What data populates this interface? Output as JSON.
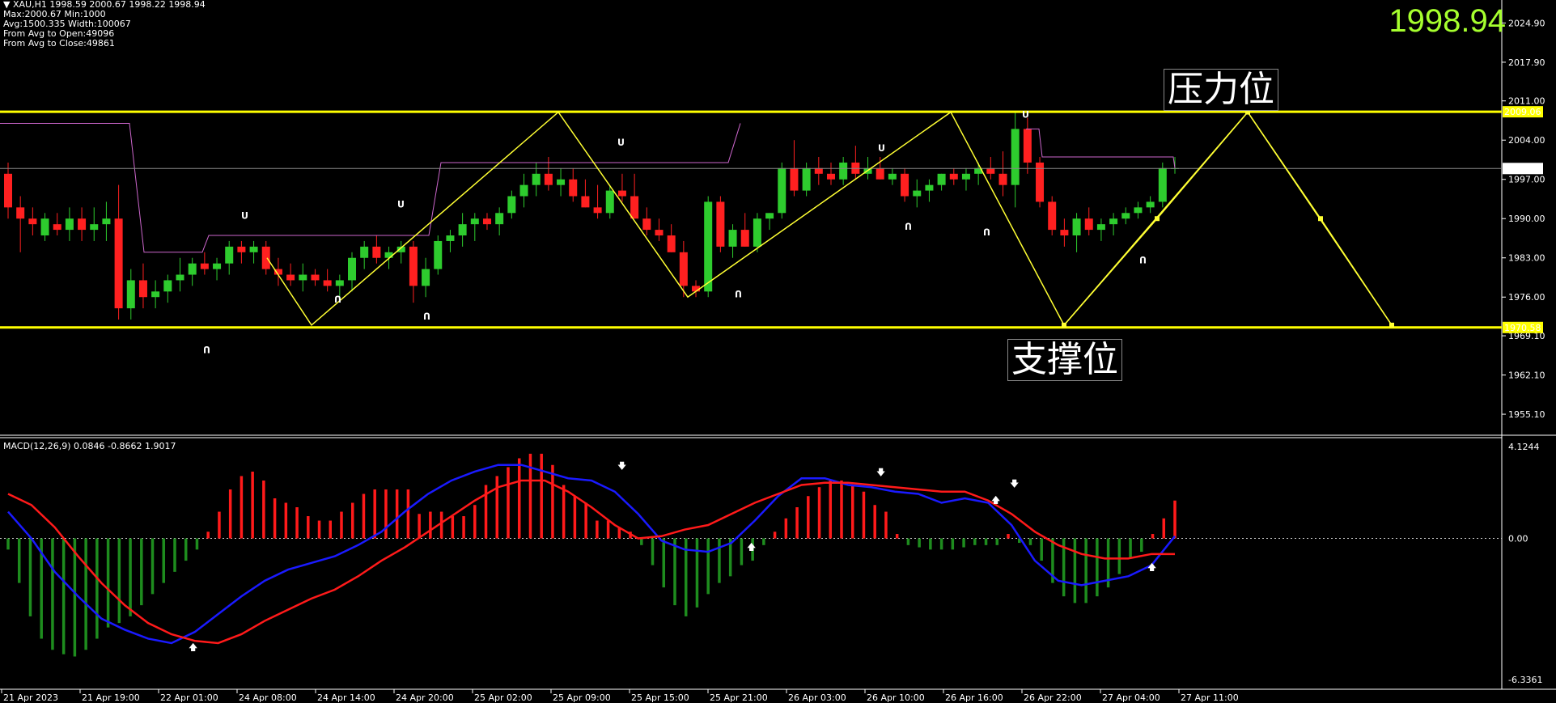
{
  "header": {
    "symbol": "XAU,H1",
    "ohlc": "1998.59 2000.67 1998.22 1998.94",
    "line2": "Max:2000.67 Min:1000",
    "line3": "Avg:1500.335 Width:100067",
    "line4": "From Avg to Open:49096",
    "line5": "From Avg to Close:49861",
    "big_price": "1998.94"
  },
  "annotations": {
    "resistance_label": "压力位",
    "support_label": "支撑位"
  },
  "colors": {
    "bull": "#2ecc2e",
    "bear": "#ff2020",
    "level": "#ffff00",
    "zigzag": "#ffff33",
    "envelope": "#cc66cc",
    "macd_fast": "#1a1aff",
    "macd_signal": "#ff1a1a",
    "hist_pos": "#ff1a1a",
    "hist_neg": "#1e8c1e",
    "price_big": "#a6ff2e"
  },
  "chart_data": [
    {
      "type": "candlestick",
      "title": "XAU,H1",
      "y_ticks": [
        "2024.90",
        "2017.90",
        "2011.00",
        "2004.00",
        "1997.00",
        "1990.00",
        "1983.00",
        "1976.00",
        "1969.10",
        "1962.10",
        "1955.10"
      ],
      "ylim": [
        1951.5,
        2029.0
      ],
      "current_price": "1998.94",
      "levels": [
        {
          "name": "resistance",
          "value": 2009.06,
          "label": "2009.06"
        },
        {
          "name": "support",
          "value": 1970.58,
          "label": "1970.58"
        }
      ],
      "x_ticks": [
        "21 Apr 2023",
        "21 Apr 19:00",
        "22 Apr 01:00",
        "24 Apr 08:00",
        "24 Apr 14:00",
        "24 Apr 20:00",
        "25 Apr 02:00",
        "25 Apr 09:00",
        "25 Apr 15:00",
        "25 Apr 21:00",
        "26 Apr 03:00",
        "26 Apr 10:00",
        "26 Apr 16:00",
        "26 Apr 22:00",
        "27 Apr 04:00",
        "27 Apr 11:00"
      ],
      "candles": [
        [
          1998,
          2000,
          1990,
          1992
        ],
        [
          1992,
          1994,
          1984,
          1990
        ],
        [
          1990,
          1992,
          1987,
          1989
        ],
        [
          1987,
          1991,
          1986,
          1990
        ],
        [
          1989,
          1991,
          1987,
          1988
        ],
        [
          1988,
          1992,
          1986,
          1990
        ],
        [
          1990,
          1992,
          1986,
          1988
        ],
        [
          1988,
          1992,
          1986,
          1989
        ],
        [
          1989,
          1993,
          1986,
          1990
        ],
        [
          1990,
          1996,
          1972,
          1974
        ],
        [
          1974,
          1981,
          1972,
          1979
        ],
        [
          1979,
          1982,
          1974,
          1976
        ],
        [
          1976,
          1979,
          1974,
          1977
        ],
        [
          1977,
          1980,
          1975,
          1979
        ],
        [
          1979,
          1983,
          1977,
          1980
        ],
        [
          1980,
          1983,
          1978,
          1982
        ],
        [
          1982,
          1984,
          1980,
          1981
        ],
        [
          1981,
          1983,
          1979,
          1982
        ],
        [
          1982,
          1986,
          1980,
          1985
        ],
        [
          1985,
          1986,
          1982,
          1984
        ],
        [
          1984,
          1986,
          1982,
          1985
        ],
        [
          1985,
          1986,
          1980,
          1981
        ],
        [
          1981,
          1983,
          1978,
          1980
        ],
        [
          1980,
          1982,
          1978,
          1979
        ],
        [
          1979,
          1982,
          1977,
          1980
        ],
        [
          1980,
          1981,
          1978,
          1979
        ],
        [
          1979,
          1981,
          1977,
          1978
        ],
        [
          1978,
          1980,
          1976,
          1979
        ],
        [
          1979,
          1984,
          1977,
          1983
        ],
        [
          1983,
          1986,
          1981,
          1985
        ],
        [
          1985,
          1987,
          1982,
          1983
        ],
        [
          1983,
          1985,
          1981,
          1984
        ],
        [
          1984,
          1986,
          1982,
          1985
        ],
        [
          1985,
          1986,
          1975,
          1978
        ],
        [
          1978,
          1983,
          1976,
          1981
        ],
        [
          1981,
          1987,
          1980,
          1986
        ],
        [
          1986,
          1988,
          1984,
          1987
        ],
        [
          1987,
          1991,
          1985,
          1989
        ],
        [
          1989,
          1991,
          1986,
          1990
        ],
        [
          1990,
          1991,
          1988,
          1989
        ],
        [
          1989,
          1992,
          1987,
          1991
        ],
        [
          1991,
          1995,
          1990,
          1994
        ],
        [
          1994,
          1998,
          1992,
          1996
        ],
        [
          1996,
          2000,
          1994,
          1998
        ],
        [
          1998,
          2001,
          1995,
          1996
        ],
        [
          1996,
          1999,
          1994,
          1997
        ],
        [
          1997,
          1999,
          1993,
          1994
        ],
        [
          1994,
          1997,
          1992,
          1992
        ],
        [
          1992,
          1996,
          1990,
          1991
        ],
        [
          1991,
          1996,
          1990,
          1995
        ],
        [
          1995,
          1998,
          1993,
          1994
        ],
        [
          1994,
          1998,
          1990,
          1990
        ],
        [
          1990,
          1992,
          1987,
          1988
        ],
        [
          1988,
          1990,
          1986,
          1987
        ],
        [
          1987,
          1989,
          1984,
          1984
        ],
        [
          1984,
          1986,
          1976,
          1978
        ],
        [
          1978,
          1979,
          1976,
          1977
        ],
        [
          1977,
          1994,
          1976,
          1993
        ],
        [
          1993,
          1994,
          1984,
          1985
        ],
        [
          1985,
          1989,
          1983,
          1988
        ],
        [
          1988,
          1991,
          1985,
          1985
        ],
        [
          1985,
          1991,
          1984,
          1990
        ],
        [
          1990,
          1991,
          1988,
          1991
        ],
        [
          1991,
          2000,
          1990,
          1999
        ],
        [
          1999,
          2004,
          1994,
          1995
        ],
        [
          1995,
          2000,
          1994,
          1999
        ],
        [
          1999,
          2001,
          1996,
          1998
        ],
        [
          1998,
          2000,
          1996,
          1997
        ],
        [
          1997,
          2001,
          1996,
          2000
        ],
        [
          2000,
          2003,
          1997,
          1998
        ],
        [
          1998,
          2001,
          1997,
          1999
        ],
        [
          1999,
          2001,
          1997,
          1997
        ],
        [
          1997,
          1999,
          1996,
          1998
        ],
        [
          1998,
          1999,
          1993,
          1994
        ],
        [
          1994,
          1997,
          1992,
          1995
        ],
        [
          1995,
          1997,
          1993,
          1996
        ],
        [
          1996,
          1998,
          1995,
          1998
        ],
        [
          1998,
          1999,
          1996,
          1997
        ],
        [
          1997,
          1999,
          1995,
          1998
        ],
        [
          1998,
          2000,
          1996,
          1999
        ],
        [
          1999,
          2001,
          1997,
          1998
        ],
        [
          1998,
          2002,
          1994,
          1996
        ],
        [
          1996,
          2009,
          1992,
          2006
        ],
        [
          2006,
          2008,
          1998,
          2000
        ],
        [
          2000,
          2001,
          1992,
          1993
        ],
        [
          1993,
          1994,
          1987,
          1988
        ],
        [
          1988,
          1990,
          1985,
          1987
        ],
        [
          1987,
          1991,
          1984,
          1990
        ],
        [
          1990,
          1992,
          1987,
          1988
        ],
        [
          1988,
          1990,
          1986,
          1989
        ],
        [
          1989,
          1991,
          1987,
          1990
        ],
        [
          1990,
          1992,
          1989,
          1991
        ],
        [
          1991,
          1993,
          1990,
          1992
        ],
        [
          1992,
          1994,
          1991,
          1993
        ],
        [
          1993,
          2000,
          1992,
          1999
        ],
        [
          1999,
          2001,
          1998,
          1999
        ]
      ]
    },
    {
      "type": "line",
      "title": "MACD(12,26,9)",
      "values_text": "0.0846 -0.8662 1.9017",
      "y_ticks": [
        "4.1244",
        "0.00",
        "-6.3361"
      ],
      "ylim": [
        -6.3361,
        4.1244
      ]
    }
  ]
}
